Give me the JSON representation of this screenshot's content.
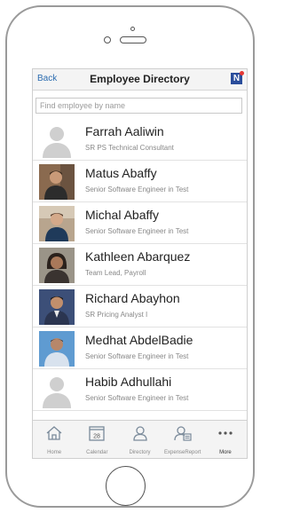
{
  "nav": {
    "back_label": "Back",
    "title": "Employee Directory",
    "logo_letter": "N"
  },
  "search": {
    "placeholder": "Find employee by name"
  },
  "employees": [
    {
      "name": "Farrah Aaliwin",
      "title": "SR PS Technical Consultant",
      "photo": "generic"
    },
    {
      "name": "Matus Abaffy",
      "title": "Senior Software Engineer in Test",
      "photo": "photo"
    },
    {
      "name": "Michal Abaffy",
      "title": "Senior Software Engineer in Test",
      "photo": "photo"
    },
    {
      "name": "Kathleen Abarquez",
      "title": "Team Lead, Payroll",
      "photo": "photo"
    },
    {
      "name": "Richard Abayhon",
      "title": "SR Pricing Analyst I",
      "photo": "photo"
    },
    {
      "name": "Medhat AbdelBadie",
      "title": "Senior Software Engineer in Test",
      "photo": "photo"
    },
    {
      "name": "Habib Adhullahi",
      "title": "Senior Software Engineer in Test",
      "photo": "generic"
    }
  ],
  "tabs": [
    {
      "label": "Home",
      "icon": "home-icon"
    },
    {
      "label": "Calendar",
      "icon": "calendar-icon",
      "day": "28"
    },
    {
      "label": "Directory",
      "icon": "directory-icon"
    },
    {
      "label": "ExpenseReport",
      "icon": "expense-report-icon"
    },
    {
      "label": "More",
      "icon": "more-icon"
    }
  ],
  "colors": {
    "accent": "#2b6cb0",
    "logo": "#2a4d9b",
    "logo_badge": "#e53935"
  }
}
